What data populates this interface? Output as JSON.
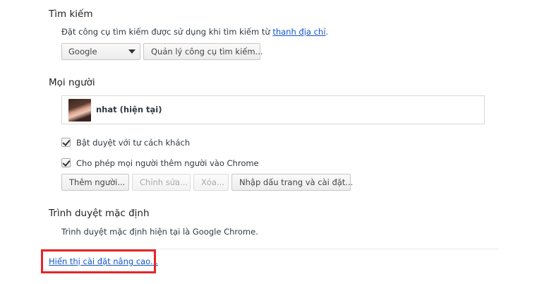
{
  "search": {
    "title": "Tìm kiếm",
    "description": "Đặt công cụ tìm kiếm được sử dụng khi tìm kiếm từ ",
    "description_link": "thanh địa chỉ",
    "description_end": ".",
    "engine_selected": "Google",
    "manage_button": "Quản lý công cụ tìm kiếm..."
  },
  "people": {
    "title": "Mọi người",
    "profile_name": "nhat (hiện tại)",
    "guest_checkbox_label": "Bật duyệt với tư cách khách",
    "guest_checked": true,
    "allow_add_checkbox_label": "Cho phép mọi người thêm người vào Chrome",
    "allow_add_checked": true,
    "buttons": {
      "add": "Thêm người...",
      "edit": "Chỉnh sửa...",
      "remove": "Xóa...",
      "import": "Nhập dấu trang và cài đặt..."
    }
  },
  "default_browser": {
    "title": "Trình duyệt mặc định",
    "status": "Trình duyệt mặc định hiện tại là Google Chrome."
  },
  "advanced": {
    "link": "Hiển thị cài đặt nâng cao..."
  },
  "colors": {
    "link": "#1155cc",
    "highlight": "#e5252a"
  }
}
